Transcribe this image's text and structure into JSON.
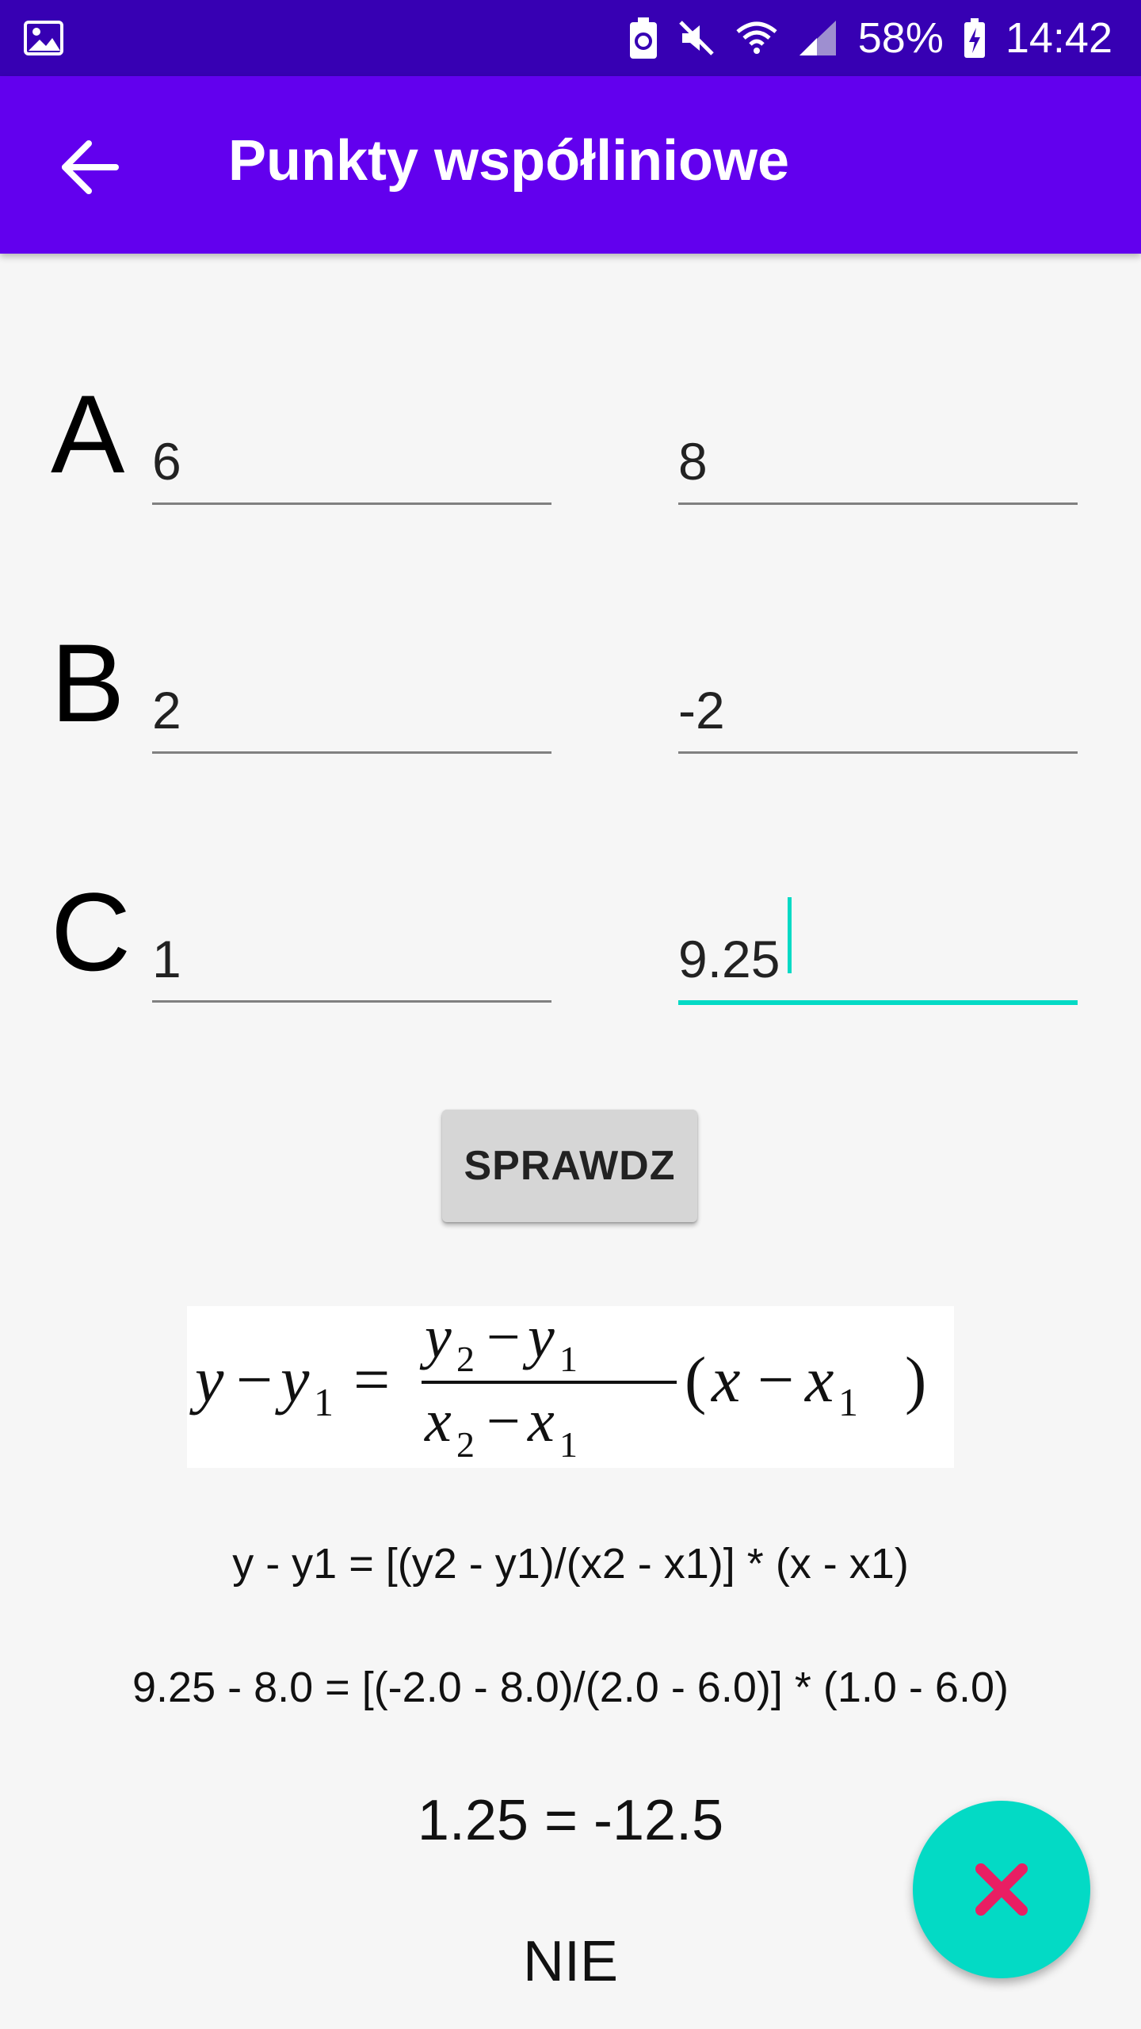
{
  "status_bar": {
    "battery_percent": "58%",
    "time": "14:42",
    "icons": [
      "gallery-icon",
      "battery-saver-icon",
      "mute-icon",
      "wifi-icon",
      "signal-icon",
      "charging-battery-icon"
    ]
  },
  "app_bar": {
    "title": "Punkty współliniowe",
    "back_icon": "arrow-back-icon"
  },
  "points": [
    {
      "label": "A",
      "x": "6",
      "y": "8"
    },
    {
      "label": "B",
      "x": "2",
      "y": "-2"
    },
    {
      "label": "C",
      "x": "1",
      "y": "9.25"
    }
  ],
  "check_button": {
    "label": "SPRAWDZ"
  },
  "formula_image": {
    "description_icon": "line-equation-image"
  },
  "result": {
    "formula_text": "y - y1 = [(y2 - y1)/(x2 - x1)] * (x - x1)",
    "substitution": "9.25 - 8.0 = [(-2.0 - 8.0)/(2.0 - 6.0)] * (1.0 - 6.0)",
    "evaluation": "1.25 = -12.5",
    "answer": "NIE"
  },
  "fab": {
    "icon": "close-icon"
  },
  "colors": {
    "status_bar": "#3700b3",
    "app_bar": "#6200ee",
    "accent": "#03dac5",
    "fab_icon": "#e91e63"
  }
}
